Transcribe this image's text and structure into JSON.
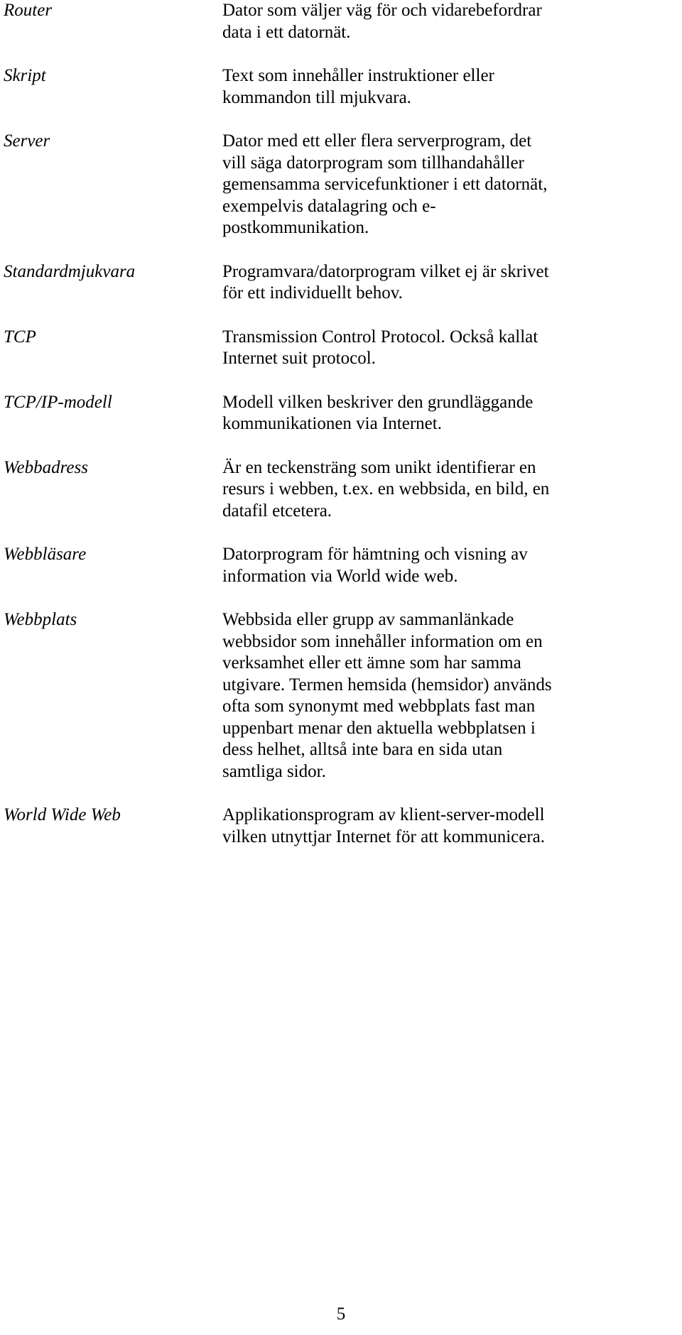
{
  "document": {
    "language": "sv",
    "page_number": "5"
  },
  "glossary": {
    "entries": [
      {
        "term": "Router",
        "definition_lines": [
          "Dator som väljer väg för och vidarebefordrar",
          "data i ett datornät."
        ],
        "gap_before": 0
      },
      {
        "term": "Skript",
        "definition_lines": [
          "Text som innehåller instruktioner eller",
          "kommandon till mjukvara."
        ],
        "gap_before": 31
      },
      {
        "term": "Server",
        "definition_lines": [
          "Dator med ett eller flera serverprogram, det",
          "vill säga datorprogram som tillhandahåller",
          "gemensamma servicefunktioner i ett datornät,",
          "exempelvis datalagring och e-",
          "postkommunikation."
        ],
        "gap_before": 31
      },
      {
        "term": "Standardmjukvara",
        "definition_lines": [
          "Programvara/datorprogram vilket ej är skrivet",
          "för ett individuellt behov."
        ],
        "gap_before": 31
      },
      {
        "term": "TCP",
        "definition_lines": [
          "Transmission Control Protocol. Också kallat",
          "Internet suit protocol."
        ],
        "gap_before": 31
      },
      {
        "term": "TCP/IP-modell",
        "definition_lines": [
          "Modell vilken beskriver den grundläggande",
          "kommunikationen via Internet."
        ],
        "gap_before": 31
      },
      {
        "term": "Webbadress",
        "definition_lines": [
          "Är en teckensträng som unikt identifierar en",
          "resurs i webben, t.ex. en webbsida, en bild, en",
          "datafil etcetera."
        ],
        "gap_before": 31
      },
      {
        "term": "Webbläsare",
        "definition_lines": [
          "Datorprogram för hämtning och visning av",
          "information via World wide web."
        ],
        "gap_before": 31
      },
      {
        "term": "Webbplats",
        "definition_lines": [
          "Webbsida eller grupp av sammanlänkade",
          "webbsidor som innehåller information om en",
          "verksamhet eller ett ämne som har samma",
          "utgivare. Termen hemsida (hemsidor) används",
          "ofta som synonymt med webbplats fast man",
          "uppenbart menar den aktuella webbplatsen i",
          "dess helhet, alltså inte bara en sida utan",
          "samtliga sidor."
        ],
        "gap_before": 31
      },
      {
        "term": "World Wide Web",
        "definition_lines": [
          "Applikationsprogram av klient-server-modell",
          "vilken utnyttjar Internet för att kommunicera."
        ],
        "gap_before": 31
      }
    ]
  }
}
